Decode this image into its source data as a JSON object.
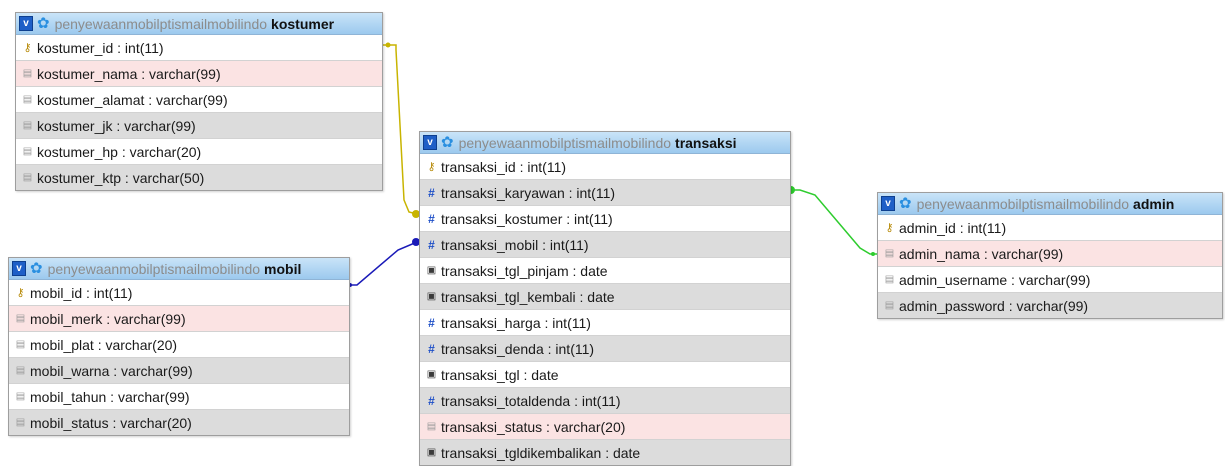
{
  "tables": [
    {
      "id": "kostumer",
      "database": "penyewaanmobilptismailmobilindo",
      "name": "kostumer",
      "columns": [
        {
          "label": "kostumer_id : int(11)",
          "icon": "key-icon",
          "row": "white"
        },
        {
          "label": "kostumer_nama : varchar(99)",
          "icon": "text-field-icon",
          "row": "pink"
        },
        {
          "label": "kostumer_alamat : varchar(99)",
          "icon": "text-field-icon",
          "row": "white"
        },
        {
          "label": "kostumer_jk : varchar(99)",
          "icon": "text-field-icon",
          "row": "gray"
        },
        {
          "label": "kostumer_hp : varchar(20)",
          "icon": "text-field-icon",
          "row": "white"
        },
        {
          "label": "kostumer_ktp : varchar(50)",
          "icon": "text-field-icon",
          "row": "gray"
        }
      ]
    },
    {
      "id": "mobil",
      "database": "penyewaanmobilptismailmobilindo",
      "name": "mobil",
      "columns": [
        {
          "label": "mobil_id : int(11)",
          "icon": "key-icon",
          "row": "white"
        },
        {
          "label": "mobil_merk : varchar(99)",
          "icon": "text-field-icon",
          "row": "pink"
        },
        {
          "label": "mobil_plat : varchar(20)",
          "icon": "text-field-icon",
          "row": "white"
        },
        {
          "label": "mobil_warna : varchar(99)",
          "icon": "text-field-icon",
          "row": "gray"
        },
        {
          "label": "mobil_tahun : varchar(99)",
          "icon": "text-field-icon",
          "row": "white"
        },
        {
          "label": "mobil_status : varchar(20)",
          "icon": "text-field-icon",
          "row": "gray"
        }
      ]
    },
    {
      "id": "transaksi",
      "database": "penyewaanmobilptismailmobilindo",
      "name": "transaksi",
      "columns": [
        {
          "label": "transaksi_id : int(11)",
          "icon": "key-icon",
          "row": "white"
        },
        {
          "label": "transaksi_karyawan : int(11)",
          "icon": "number-icon",
          "row": "gray"
        },
        {
          "label": "transaksi_kostumer : int(11)",
          "icon": "number-icon",
          "row": "white"
        },
        {
          "label": "transaksi_mobil : int(11)",
          "icon": "number-icon",
          "row": "gray"
        },
        {
          "label": "transaksi_tgl_pinjam : date",
          "icon": "date-icon",
          "row": "white"
        },
        {
          "label": "transaksi_tgl_kembali : date",
          "icon": "date-icon",
          "row": "gray"
        },
        {
          "label": "transaksi_harga : int(11)",
          "icon": "number-icon",
          "row": "white"
        },
        {
          "label": "transaksi_denda : int(11)",
          "icon": "number-icon",
          "row": "gray"
        },
        {
          "label": "transaksi_tgl : date",
          "icon": "date-icon",
          "row": "white"
        },
        {
          "label": "transaksi_totaldenda : int(11)",
          "icon": "number-icon",
          "row": "gray"
        },
        {
          "label": "transaksi_status : varchar(20)",
          "icon": "text-field-icon",
          "row": "pink"
        },
        {
          "label": "transaksi_tgldikembalikan : date",
          "icon": "date-icon",
          "row": "gray"
        }
      ]
    },
    {
      "id": "admin",
      "database": "penyewaanmobilptismailmobilindo",
      "name": "admin",
      "columns": [
        {
          "label": "admin_id : int(11)",
          "icon": "key-icon",
          "row": "white"
        },
        {
          "label": "admin_nama : varchar(99)",
          "icon": "text-field-icon",
          "row": "pink"
        },
        {
          "label": "admin_username : varchar(99)",
          "icon": "text-field-icon",
          "row": "white"
        },
        {
          "label": "admin_password : varchar(99)",
          "icon": "text-field-icon",
          "row": "gray"
        }
      ]
    }
  ],
  "relations": [
    {
      "from": "kostumer.kostumer_id",
      "to": "transaksi.transaksi_kostumer",
      "color": "#c8b400"
    },
    {
      "from": "mobil.mobil_id",
      "to": "transaksi.transaksi_mobil",
      "color": "#1a1ab8"
    },
    {
      "from": "admin.admin_id",
      "to": "transaksi.transaksi_karyawan",
      "color": "#2ecc2e"
    }
  ],
  "toggle_glyph": "v",
  "settings_glyph": "✿"
}
